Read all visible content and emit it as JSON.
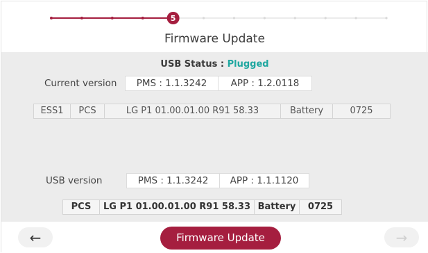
{
  "stepper": {
    "current_step": "5",
    "total_steps": 12,
    "accent_color": "#a51e3f"
  },
  "title": "Firmware Update",
  "usb_status": {
    "label": "USB Status :",
    "value": "Plugged",
    "value_color": "#1fa7a0"
  },
  "current": {
    "label": "Current version",
    "pms": "PMS : 1.1.3242",
    "app": "APP : 1.2.0118",
    "table": [
      "ESS1",
      "PCS",
      "LG P1 01.00.01.00 R91 58.33",
      "Battery",
      "0725"
    ]
  },
  "usb": {
    "label": "USB version",
    "pms": "PMS : 1.1.3242",
    "app": "APP : 1.1.1120",
    "table": [
      "PCS",
      "LG P1 01.00.01.00 R91 58.33",
      "Battery",
      "0725"
    ]
  },
  "nav": {
    "back_icon": "left-arrow",
    "back_glyph": "←",
    "update_label": "Firmware Update",
    "next_icon": "right-arrow",
    "next_glyph": "→"
  }
}
